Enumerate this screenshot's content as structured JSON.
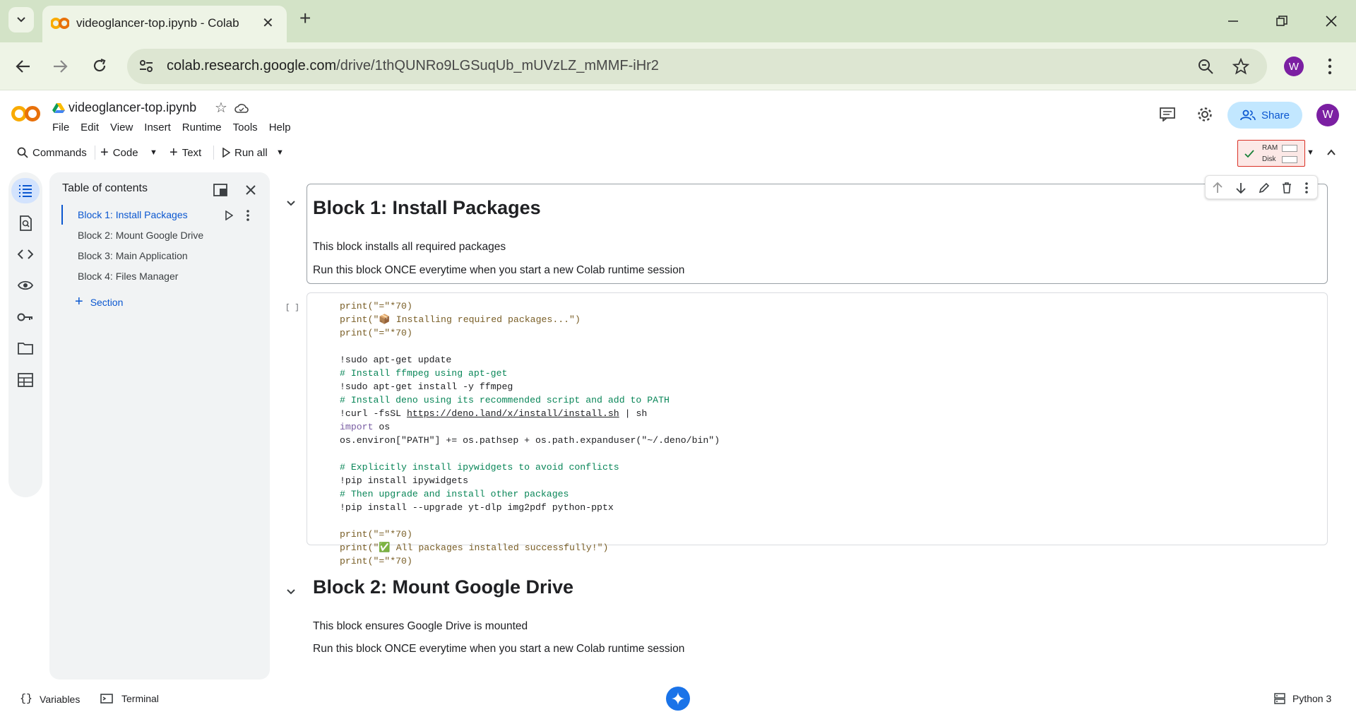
{
  "browser": {
    "tab_title": "videoglancer-top.ipynb - Colab",
    "url_host": "colab.research.google.com",
    "url_path": "/drive/1thQUNRo9LGSuqUb_mUVzLZ_mMMF-iHr2",
    "profile_initial": "W"
  },
  "colab": {
    "notebook_name": "videoglancer-top.ipynb",
    "menu": [
      "File",
      "Edit",
      "View",
      "Insert",
      "Runtime",
      "Tools",
      "Help"
    ],
    "share_label": "Share",
    "profile_initial": "W",
    "toolbar": {
      "commands": "Commands",
      "code": "Code",
      "text": "Text",
      "run_all": "Run all"
    },
    "resources": {
      "ram": "RAM",
      "disk": "Disk"
    }
  },
  "toc": {
    "title": "Table of contents",
    "items": [
      "Block 1: Install Packages",
      "Block 2: Mount Google Drive",
      "Block 3: Main Application",
      "Block 4: Files Manager"
    ],
    "add_section": "Section"
  },
  "cells": {
    "block1": {
      "heading": "Block 1: Install Packages",
      "line1": "This block installs all required packages",
      "line2": "Run this block ONCE everytime when you start a new Colab runtime session"
    },
    "code_run_indicator": "[ ]",
    "code_lines": {
      "l1": "print(\"=\"*70)",
      "l2": "print(\"📦 Installing required packages...\")",
      "l3": "print(\"=\"*70)",
      "l5": "!sudo apt-get update",
      "l6": "# Install ffmpeg using apt-get",
      "l7": "!sudo apt-get install -y ffmpeg",
      "l8": "# Install deno using its recommended script and add to PATH",
      "l9a": "!curl -fsSL ",
      "l9b": "https://deno.land/x/install/install.sh",
      "l9c": " | sh",
      "l10a": "import",
      "l10b": " os",
      "l11": "os.environ[\"PATH\"] += os.pathsep + os.path.expanduser(\"~/.deno/bin\")",
      "l13": "# Explicitly install ipywidgets to avoid conflicts",
      "l14": "!pip install ipywidgets",
      "l15": "# Then upgrade and install other packages",
      "l16": "!pip install --upgrade yt-dlp img2pdf python-pptx",
      "l18": "print(\"=\"*70)",
      "l19": "print(\"✅ All packages installed successfully!\")",
      "l20": "print(\"=\"*70)"
    },
    "block2": {
      "heading": "Block 2: Mount Google Drive",
      "line1": "This block ensures Google Drive is mounted",
      "line2": "Run this block ONCE everytime when you start a new Colab runtime session"
    }
  },
  "statusbar": {
    "variables": "Variables",
    "terminal": "Terminal",
    "runtime": "Python 3"
  },
  "colors": {
    "accent": "#1a73e8",
    "share_bg": "#c2e7ff",
    "profile": "#7b1fa2"
  }
}
